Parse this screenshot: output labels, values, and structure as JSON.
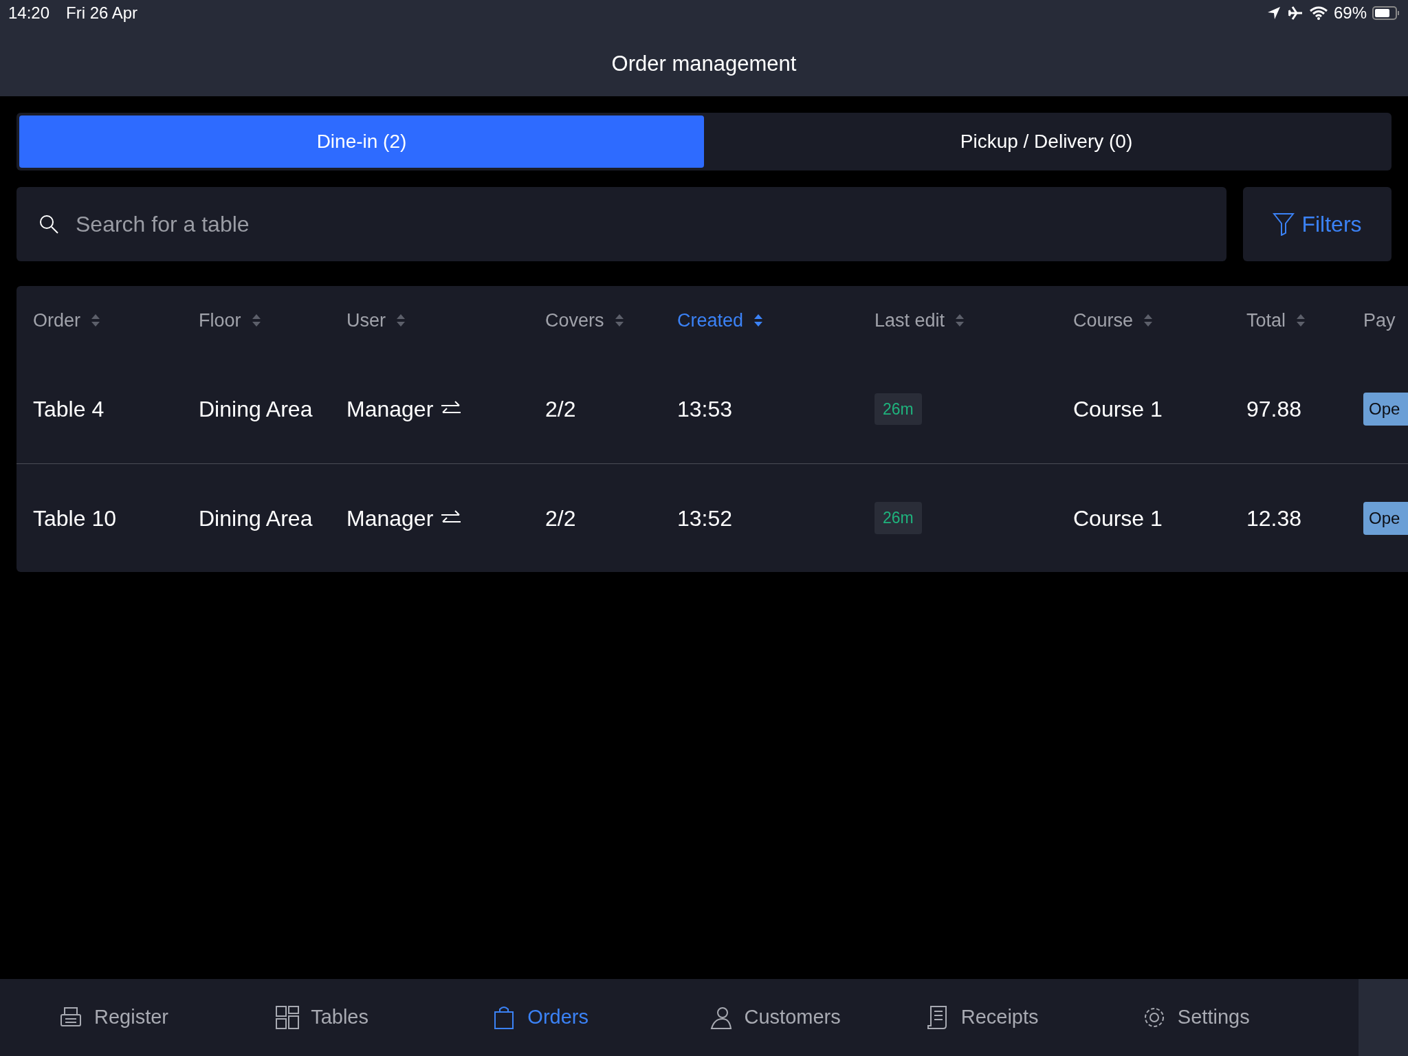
{
  "status_bar": {
    "time": "14:20",
    "date": "Fri 26 Apr",
    "battery": "69%"
  },
  "header": {
    "title": "Order management"
  },
  "tabs": [
    {
      "label": "Dine-in (2)",
      "selected": true
    },
    {
      "label": "Pickup / Delivery (0)",
      "selected": false
    }
  ],
  "search": {
    "placeholder": "Search for a table"
  },
  "filters_button": {
    "label": "Filters"
  },
  "table": {
    "columns": [
      {
        "label": "Order",
        "sorted": false,
        "sortable": true
      },
      {
        "label": "Floor",
        "sorted": false,
        "sortable": true
      },
      {
        "label": "User",
        "sorted": false,
        "sortable": true
      },
      {
        "label": "Covers",
        "sorted": false,
        "sortable": true
      },
      {
        "label": "Created",
        "sorted": true,
        "sortable": true
      },
      {
        "label": "Last edit",
        "sorted": false,
        "sortable": true
      },
      {
        "label": "Course",
        "sorted": false,
        "sortable": true
      },
      {
        "label": "Total",
        "sorted": false,
        "sortable": true
      },
      {
        "label": "Pay",
        "sorted": false,
        "sortable": false
      }
    ],
    "rows": [
      {
        "order": "Table 4",
        "floor": "Dining Area",
        "user": "Manager",
        "covers": "2/2",
        "created": "13:53",
        "last_edit": "26m",
        "course": "Course 1",
        "total": "97.88",
        "payment": "Ope"
      },
      {
        "order": "Table 10",
        "floor": "Dining Area",
        "user": "Manager",
        "covers": "2/2",
        "created": "13:52",
        "last_edit": "26m",
        "course": "Course 1",
        "total": "12.38",
        "payment": "Ope"
      }
    ]
  },
  "bottom_nav": [
    {
      "label": "Register",
      "selected": false
    },
    {
      "label": "Tables",
      "selected": false
    },
    {
      "label": "Orders",
      "selected": true
    },
    {
      "label": "Customers",
      "selected": false
    },
    {
      "label": "Receipts",
      "selected": false
    },
    {
      "label": "Settings",
      "selected": false
    }
  ]
}
